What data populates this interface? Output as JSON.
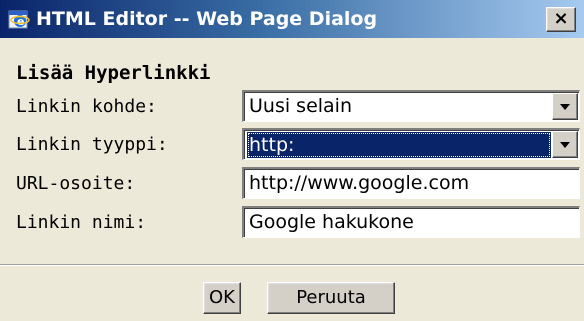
{
  "window": {
    "title": "HTML Editor -- Web Page Dialog",
    "close_label": "×"
  },
  "form": {
    "heading": "Lisää Hyperlinkki",
    "fields": [
      {
        "label": "Linkin kohde:",
        "value": "Uusi selain",
        "type": "select",
        "selected": false
      },
      {
        "label": "Linkin tyyppi:",
        "value": "http:",
        "type": "select",
        "selected": true
      },
      {
        "label": "URL-osoite:",
        "value": "http://www.google.com",
        "type": "text"
      },
      {
        "label": "Linkin nimi:",
        "value": "Google hakukone",
        "type": "text"
      }
    ]
  },
  "buttons": {
    "ok": "OK",
    "cancel": "Peruuta"
  },
  "icons": {
    "title": "ie-icon",
    "dropdown": "chevron-down-icon"
  },
  "colors": {
    "titlebar_start": "#0a246a",
    "titlebar_end": "#a6caf0",
    "dialog_bg": "#ece9d8",
    "selection": "#0a246a"
  }
}
